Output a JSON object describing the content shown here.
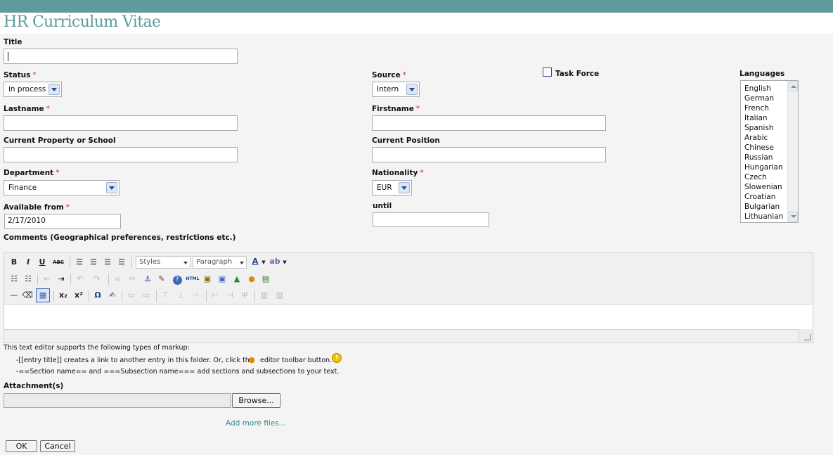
{
  "header": {
    "title": "HR Curriculum Vitae"
  },
  "colors": {
    "accent": "#5e9b9a",
    "required": "#c62828",
    "link": "#3a8a8a"
  },
  "required_marker": "*",
  "form": {
    "title": {
      "label": "Title",
      "value": ""
    },
    "status": {
      "label": "Status",
      "value": "in process"
    },
    "source": {
      "label": "Source",
      "value": "Intern"
    },
    "task_force": {
      "label": "Task Force",
      "checked": false
    },
    "languages": {
      "label": "Languages",
      "options": [
        "English",
        "German",
        "French",
        "Italian",
        "Spanish",
        "Arabic",
        "Chinese",
        "Russian",
        "Hungarian",
        "Czech",
        "Slowenian",
        "Croatian",
        "Bulgarian",
        "Lithuanian"
      ]
    },
    "lastname": {
      "label": "Lastname",
      "value": ""
    },
    "firstname": {
      "label": "Firstname",
      "value": ""
    },
    "current_property": {
      "label": "Current Property or School",
      "value": ""
    },
    "current_position": {
      "label": "Current Position",
      "value": ""
    },
    "department": {
      "label": "Department",
      "value": "Finance"
    },
    "nationality": {
      "label": "Nationality",
      "value": "EUR"
    },
    "available_from": {
      "label": "Available from",
      "value": "2/17/2010"
    },
    "until": {
      "label": "until",
      "value": ""
    },
    "comments": {
      "label": "Comments (Geographical preferences, restrictions etc.)"
    }
  },
  "editor": {
    "styles_label": "Styles",
    "format_label": "Paragraph",
    "bold": "B",
    "italic": "I",
    "underline": "U",
    "strike": "ABC",
    "html_label": "HTML",
    "subscript": "x₂",
    "superscript": "x²",
    "omega": "Ω",
    "font_color": "A",
    "markup_intro": "This text editor supports the following types of markup:",
    "markup_line1": "-[[entry title]] creates a link to another entry in this folder. Or, click the",
    "markup_line1_tail": "editor toolbar button.",
    "markup_line2": "-==Section name== and ===Subsection name=== add sections and subsections to your text."
  },
  "attachments": {
    "label": "Attachment(s)",
    "browse": "Browse...",
    "add_more": "Add more files..."
  },
  "actions": {
    "ok": "OK",
    "cancel": "Cancel"
  }
}
